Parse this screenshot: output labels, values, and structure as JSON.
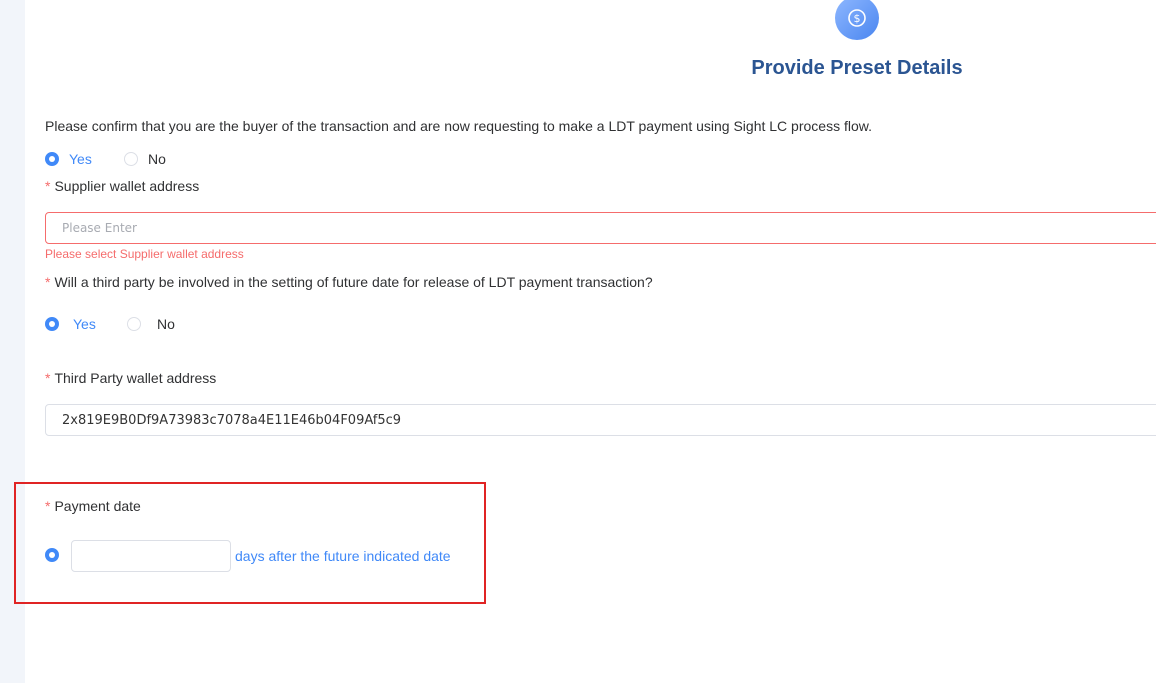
{
  "header": {
    "icon": "dollar-exchange-icon",
    "title": "Provide Preset Details"
  },
  "confirm": {
    "question": "Please confirm that you are the buyer of the transaction and are now requesting to make a LDT payment using Sight LC process flow.",
    "yes_label": "Yes",
    "no_label": "No",
    "selected": "Yes"
  },
  "supplier": {
    "required_mark": "*",
    "label": "Supplier wallet address",
    "placeholder": "Please Enter",
    "value": "",
    "error": "Please select Supplier wallet address"
  },
  "third_party": {
    "required_mark": "*",
    "question": "Will a third party be involved in the setting of future date for release of LDT payment transaction?",
    "yes_label": "Yes",
    "no_label": "No",
    "selected": "Yes"
  },
  "third_party_wallet": {
    "required_mark": "*",
    "label": "Third Party wallet address",
    "value": "2x819E9B0Df9A73983c7078a4E11E46b04F09Af5c9"
  },
  "payment_date": {
    "required_mark": "*",
    "label": "Payment date",
    "days_value": "",
    "days_suffix": "days after the future indicated date"
  },
  "colors": {
    "accent": "#4089f8",
    "title": "#2b5592",
    "error": "#f56c6c",
    "highlight": "#e02424"
  }
}
